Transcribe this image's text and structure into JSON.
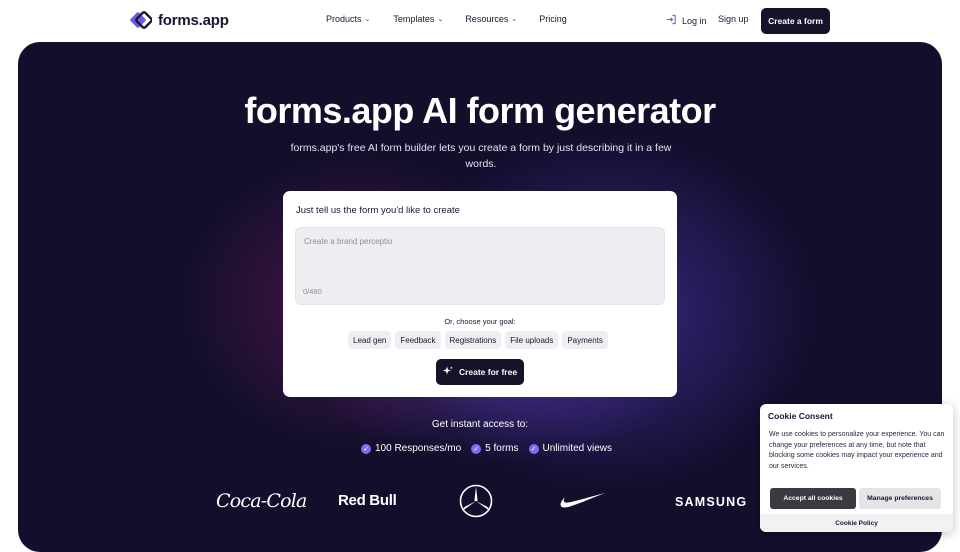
{
  "nav": {
    "brand": "forms.app",
    "menu": [
      {
        "label": "Products",
        "has_dropdown": true
      },
      {
        "label": "Templates",
        "has_dropdown": true
      },
      {
        "label": "Resources",
        "has_dropdown": true
      },
      {
        "label": "Pricing",
        "has_dropdown": false
      }
    ],
    "login_label": "Log in",
    "signup_label": "Sign up",
    "cta_label": "Create a form"
  },
  "hero": {
    "title": "forms.app AI form generator",
    "subtitle": "forms.app's free AI form builder lets you create a form by just describing it in a few words.",
    "card": {
      "prompt_label": "Just tell us the form you'd like to create",
      "textarea_value": "Create a brand perceptio",
      "char_counter": "0/480",
      "goal_label": "Or, choose your goal:",
      "goals": [
        "Lead gen",
        "Feedback",
        "Registrations",
        "File uploads",
        "Payments"
      ],
      "submit_label": "Create for free"
    },
    "access_label": "Get instant access to:",
    "perks": [
      "100 Responses/mo",
      "5 forms",
      "Unlimited views"
    ],
    "brands": {
      "coke": "Coca-Cola",
      "redbull": "Red Bull",
      "samsung": "SAMSUNG"
    }
  },
  "cookie": {
    "title": "Cookie Consent",
    "text": "We use cookies to personalize your experience. You can change your preferences at any time, but note that blocking some cookies may impact your experience and our services.",
    "accept_label": "Accept all cookies",
    "manage_label": "Manage preferences",
    "policy_label": "Cookie Policy"
  },
  "colors": {
    "hero_bg": "#120e2c",
    "dark_button": "#15122a",
    "accent": "#7b6cf0"
  }
}
